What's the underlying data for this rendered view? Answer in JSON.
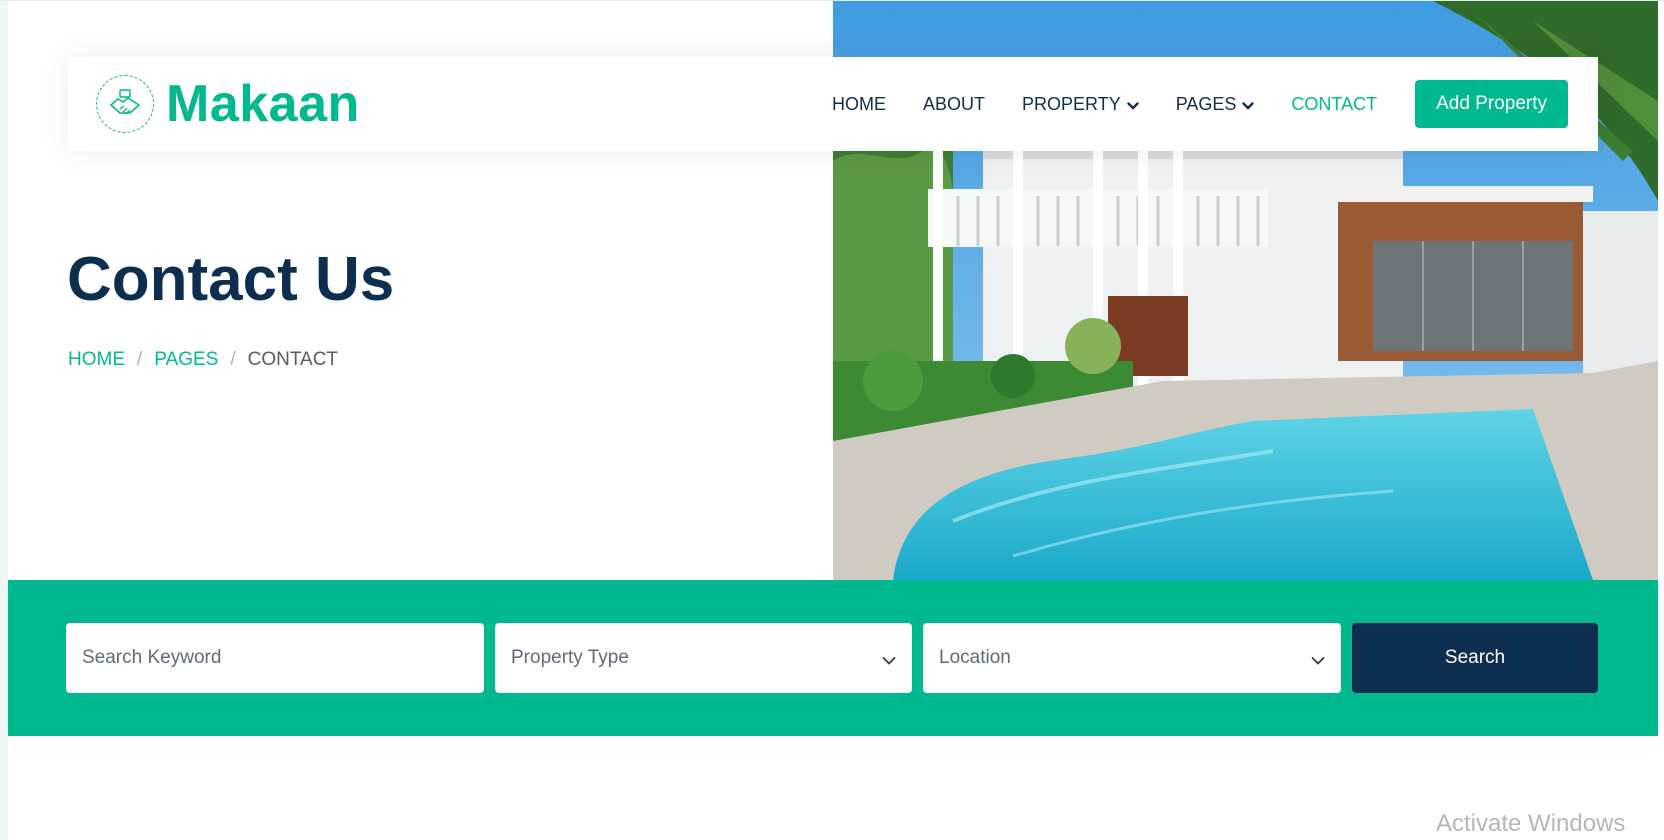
{
  "brand": {
    "name": "Makaan",
    "icon": "handshake-logo-icon"
  },
  "nav": {
    "items": [
      {
        "label": "HOME",
        "active": false,
        "dropdown": false
      },
      {
        "label": "ABOUT",
        "active": false,
        "dropdown": false
      },
      {
        "label": "PROPERTY",
        "active": false,
        "dropdown": true
      },
      {
        "label": "PAGES",
        "active": false,
        "dropdown": true
      },
      {
        "label": "CONTACT",
        "active": true,
        "dropdown": false
      }
    ],
    "cta_label": "Add Property"
  },
  "hero": {
    "title": "Contact Us",
    "breadcrumb": {
      "home": "HOME",
      "pages": "PAGES",
      "current": "CONTACT",
      "separator": "/"
    },
    "image": "house-with-pool-photo"
  },
  "search": {
    "keyword_placeholder": "Search Keyword",
    "property_type": "Property Type",
    "location": "Location",
    "button_label": "Search"
  },
  "watermark": "Activate Windows",
  "colors": {
    "accent": "#00b98e",
    "navy": "#0e2e50",
    "muted": "#616b75"
  }
}
